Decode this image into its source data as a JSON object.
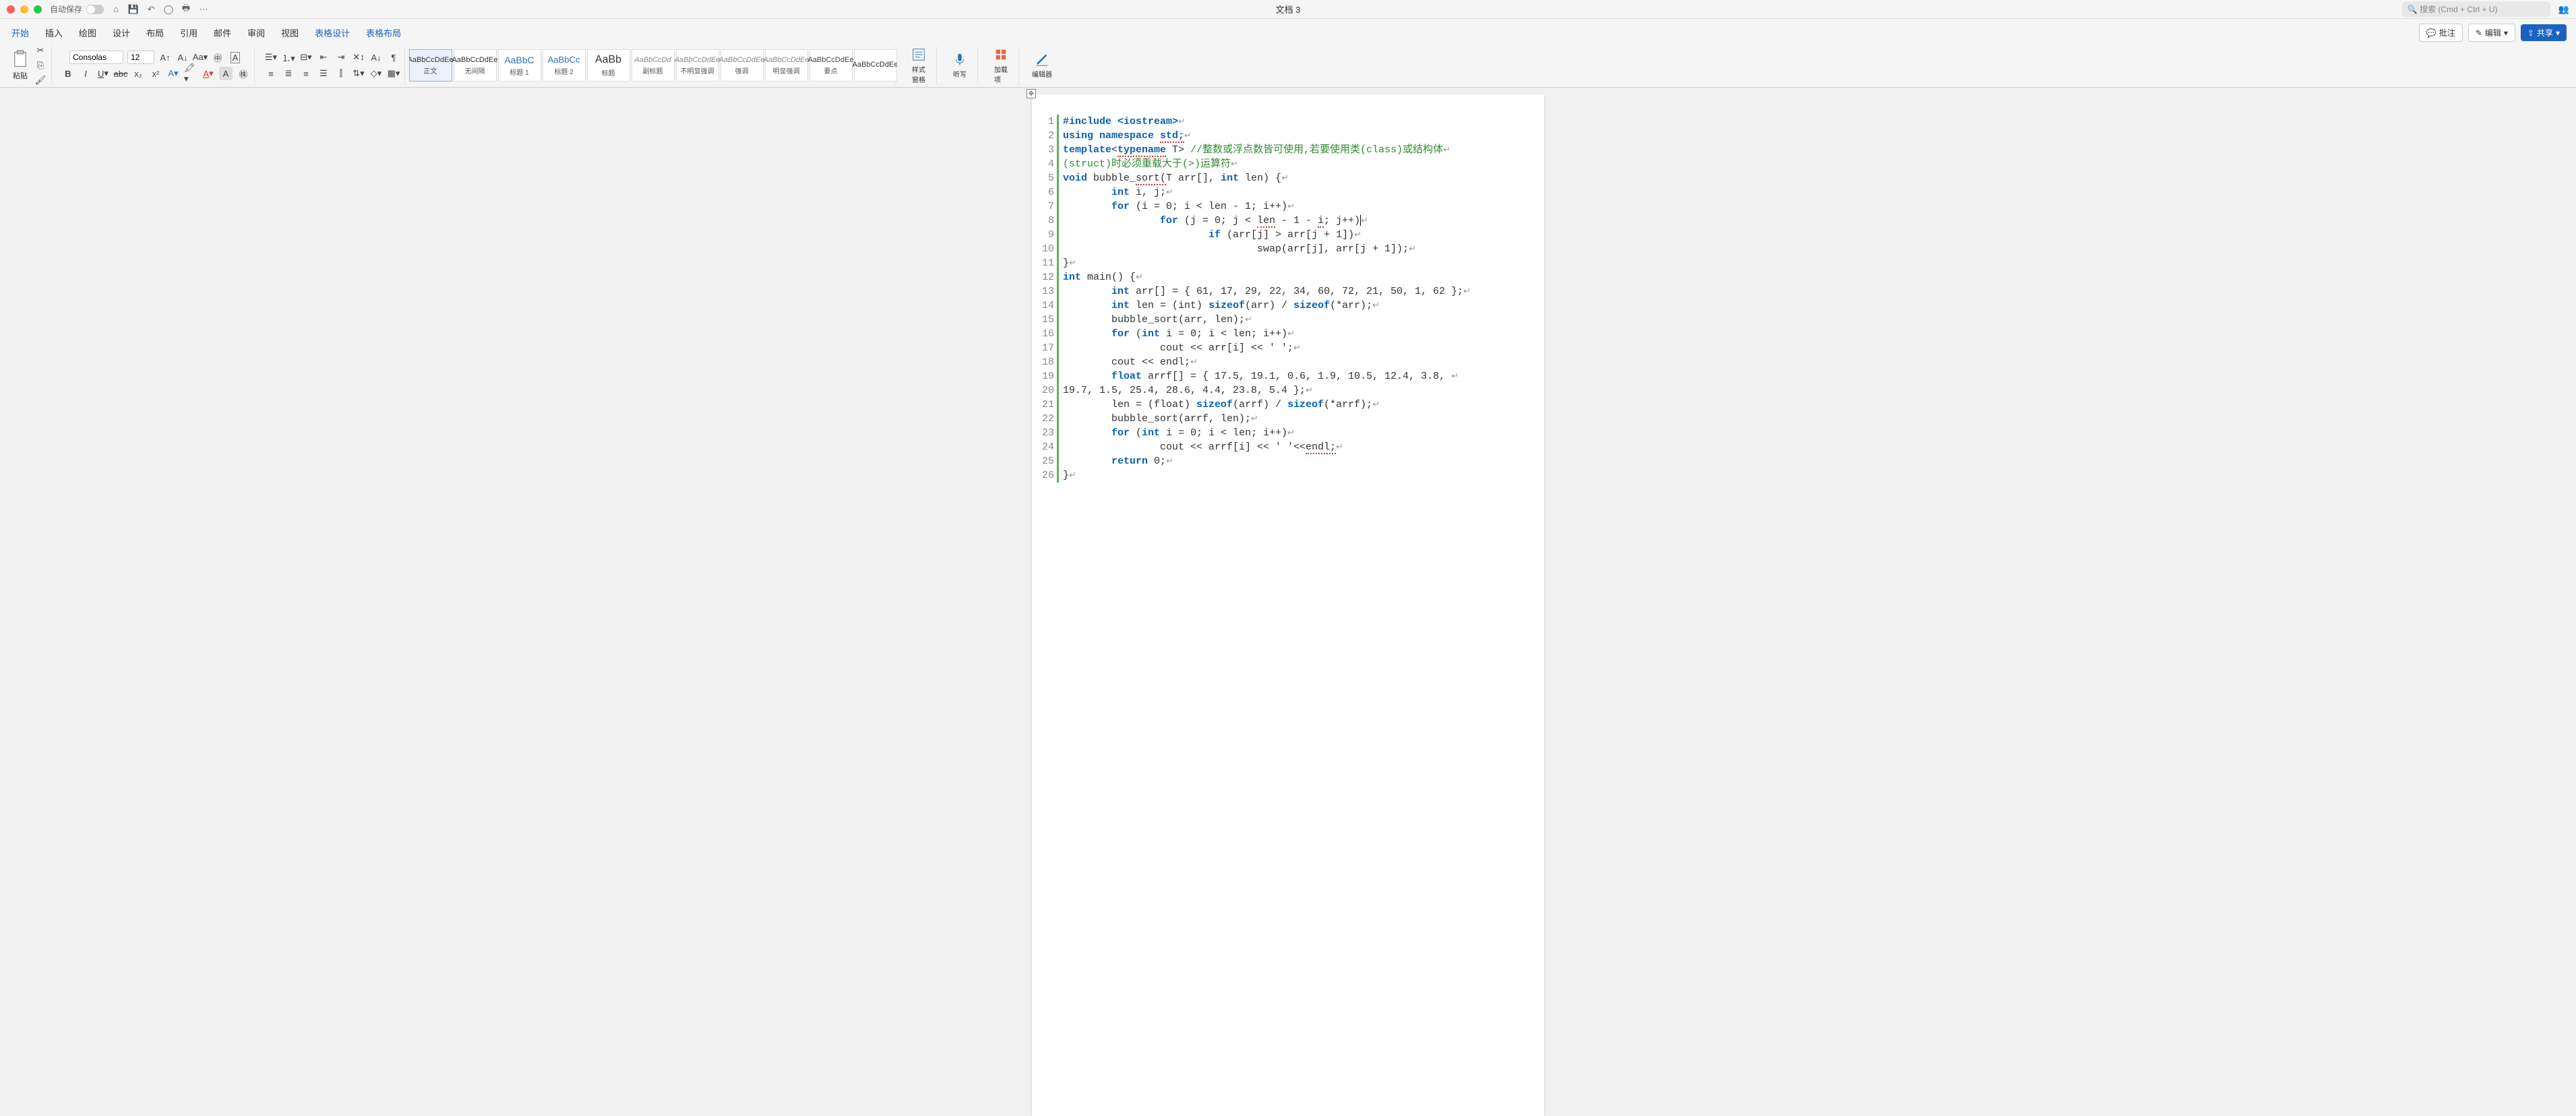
{
  "titlebar": {
    "autosave": "自动保存",
    "doc_title": "文档 3",
    "search_placeholder": "搜索 (Cmd + Ctrl + U)"
  },
  "tabs": {
    "items": [
      "开始",
      "插入",
      "绘图",
      "设计",
      "布局",
      "引用",
      "邮件",
      "审阅",
      "视图",
      "表格设计",
      "表格布局"
    ],
    "active_index": 0,
    "ctx_indices": [
      9,
      10
    ],
    "comment": "批注",
    "edit": "编辑",
    "share": "共享"
  },
  "ribbon": {
    "paste": "粘贴",
    "font_name": "Consolas",
    "font_size": "12",
    "styles": [
      {
        "prev": "AaBbCcDdEe",
        "name": "正文",
        "cls": ""
      },
      {
        "prev": "AaBbCcDdEe",
        "name": "无间隔",
        "cls": ""
      },
      {
        "prev": "AaBbC",
        "name": "标题 1",
        "cls": "h1"
      },
      {
        "prev": "AaBbCc",
        "name": "标题 2",
        "cls": "h2"
      },
      {
        "prev": "AaBb",
        "name": "标题",
        "cls": "title"
      },
      {
        "prev": "AaBbCcDd",
        "name": "副标题",
        "cls": "sub"
      },
      {
        "prev": "AaBbCcDdEe",
        "name": "不明显强调",
        "cls": "emph"
      },
      {
        "prev": "AaBbCcDdEe",
        "name": "强调",
        "cls": "emph"
      },
      {
        "prev": "AaBbCcDdEe",
        "name": "明显强调",
        "cls": "emph"
      },
      {
        "prev": "AaBbCcDdEe",
        "name": "要点",
        "cls": "str"
      },
      {
        "prev": "AaBbCcDdEe",
        "name": "",
        "cls": ""
      }
    ],
    "style_pane": "样式\n窗格",
    "dictate": "听写",
    "addins": "加载\n项",
    "editor": "编辑器"
  },
  "code": {
    "lines": [
      [
        {
          "t": "#include <iostream>",
          "c": "kw"
        }
      ],
      [
        {
          "t": "using namespace ",
          "c": "kw"
        },
        {
          "t": "std;",
          "c": "kw er"
        }
      ],
      [
        {
          "t": "template",
          "c": "kw"
        },
        {
          "t": "<",
          "c": ""
        },
        {
          "t": "typename",
          "c": "kw er"
        },
        {
          "t": " T> ",
          "c": ""
        },
        {
          "t": "//整数或浮点数皆可使用,若要使用类(class)或结构体",
          "c": "cm"
        }
      ],
      [
        {
          "t": "(struct)时必须重载大于(>)运算符",
          "c": "cm"
        }
      ],
      [
        {
          "t": "void",
          "c": "kw"
        },
        {
          "t": " bubble_",
          "c": ""
        },
        {
          "t": "sort(",
          "c": "er"
        },
        {
          "t": "T arr[], ",
          "c": ""
        },
        {
          "t": "int",
          "c": "kw"
        },
        {
          "t": " len) {",
          "c": ""
        }
      ],
      [
        {
          "t": "        ",
          "c": ""
        },
        {
          "t": "int",
          "c": "kw"
        },
        {
          "t": " i, j;",
          "c": ""
        }
      ],
      [
        {
          "t": "        ",
          "c": ""
        },
        {
          "t": "for",
          "c": "kw"
        },
        {
          "t": " (i = 0; i < len - 1; i++)",
          "c": ""
        }
      ],
      [
        {
          "t": "                ",
          "c": ""
        },
        {
          "t": "for",
          "c": "kw"
        },
        {
          "t": " (j = 0; j < ",
          "c": ""
        },
        {
          "t": "len",
          "c": "er"
        },
        {
          "t": " - 1 - ",
          "c": ""
        },
        {
          "t": "i",
          "c": "er"
        },
        {
          "t": "; j++)",
          "c": ""
        },
        {
          "t": "|",
          "c": "cursor-mark"
        }
      ],
      [
        {
          "t": "                        ",
          "c": ""
        },
        {
          "t": "if",
          "c": "kw"
        },
        {
          "t": " (arr[j] > arr[j + 1])",
          "c": ""
        }
      ],
      [
        {
          "t": "                                swap(arr[j], arr[j + 1]);",
          "c": ""
        }
      ],
      [
        {
          "t": "}",
          "c": ""
        }
      ],
      [
        {
          "t": "int",
          "c": "kw"
        },
        {
          "t": " main() {",
          "c": ""
        }
      ],
      [
        {
          "t": "        ",
          "c": ""
        },
        {
          "t": "int",
          "c": "kw"
        },
        {
          "t": " arr[] = { 61, 17, 29, 22, 34, 60, 72, 21, 50, 1, 62 };",
          "c": ""
        }
      ],
      [
        {
          "t": "        ",
          "c": ""
        },
        {
          "t": "int",
          "c": "kw"
        },
        {
          "t": " len = (int) ",
          "c": ""
        },
        {
          "t": "sizeof",
          "c": "kw"
        },
        {
          "t": "(arr) / ",
          "c": ""
        },
        {
          "t": "sizeof",
          "c": "kw"
        },
        {
          "t": "(*arr);",
          "c": ""
        }
      ],
      [
        {
          "t": "        bubble_sort(arr, len);",
          "c": ""
        }
      ],
      [
        {
          "t": "        ",
          "c": ""
        },
        {
          "t": "for",
          "c": "kw"
        },
        {
          "t": " (",
          "c": ""
        },
        {
          "t": "int",
          "c": "kw"
        },
        {
          "t": " i = 0; i < len; i++)",
          "c": ""
        }
      ],
      [
        {
          "t": "                cout << arr[i] << ' ';",
          "c": ""
        }
      ],
      [
        {
          "t": "        cout << endl;",
          "c": ""
        }
      ],
      [
        {
          "t": "        ",
          "c": ""
        },
        {
          "t": "float",
          "c": "kw"
        },
        {
          "t": " arrf[] = { 17.5, 19.1, 0.6, 1.9, 10.5, 12.4, 3.8, ",
          "c": ""
        }
      ],
      [
        {
          "t": "19.7, 1.5, 25.4, 28.6, 4.4, 23.8, 5.4 };",
          "c": ""
        }
      ],
      [
        {
          "t": "        len = (float) ",
          "c": ""
        },
        {
          "t": "sizeof",
          "c": "kw"
        },
        {
          "t": "(arrf) / ",
          "c": ""
        },
        {
          "t": "sizeof",
          "c": "kw"
        },
        {
          "t": "(*arrf);",
          "c": ""
        }
      ],
      [
        {
          "t": "        bubble_sort(arrf, len);",
          "c": ""
        }
      ],
      [
        {
          "t": "        ",
          "c": ""
        },
        {
          "t": "for",
          "c": "kw"
        },
        {
          "t": " (",
          "c": ""
        },
        {
          "t": "int",
          "c": "kw"
        },
        {
          "t": " i = 0; i < len; i++)",
          "c": ""
        }
      ],
      [
        {
          "t": "                cout << arrf[i] << ' '<<",
          "c": ""
        },
        {
          "t": "endl;",
          "c": "er"
        }
      ],
      [
        {
          "t": "        ",
          "c": ""
        },
        {
          "t": "return",
          "c": "kw"
        },
        {
          "t": " 0;",
          "c": ""
        }
      ],
      [
        {
          "t": "}",
          "c": ""
        }
      ]
    ]
  }
}
